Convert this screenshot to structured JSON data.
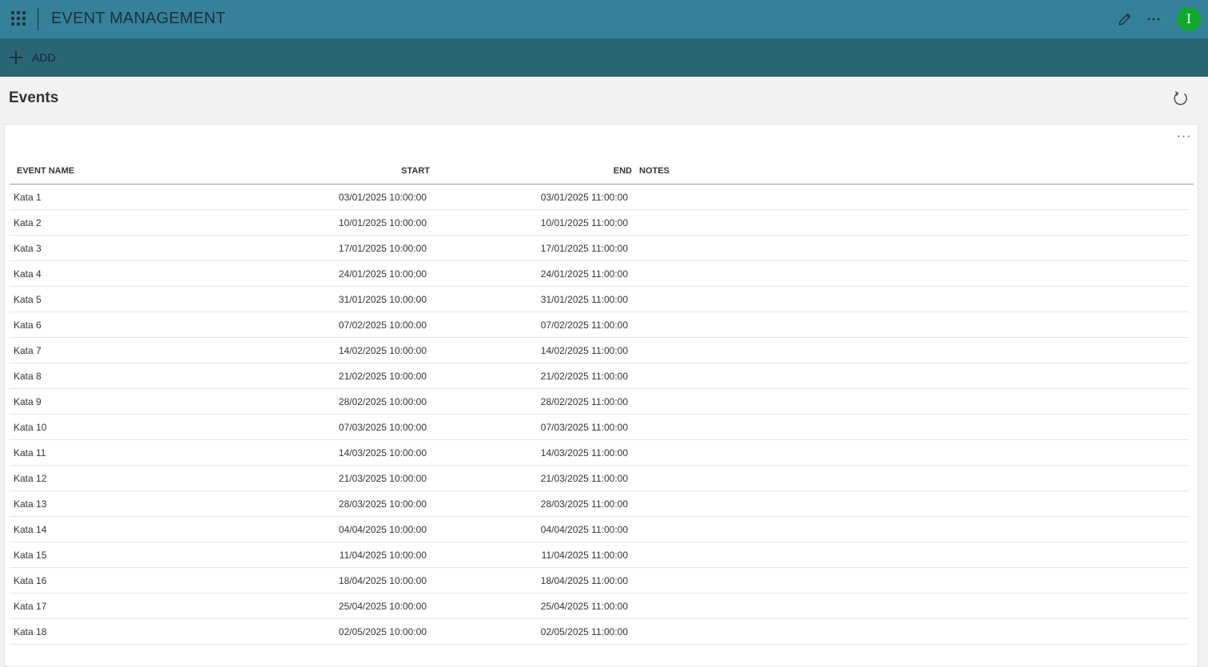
{
  "app": {
    "title": "EVENT MANAGEMENT",
    "avatar_initial": "I",
    "brand_color": "#35819a",
    "command_bar_color": "#2a6576",
    "avatar_color": "#0fa82b"
  },
  "icons": {
    "launcher": "waffle-icon",
    "edit": "pencil-icon",
    "more": "ellipsis-icon",
    "add": "plus-icon",
    "refresh": "refresh-icon"
  },
  "command_bar": {
    "add_label": "ADD"
  },
  "page": {
    "title": "Events"
  },
  "table": {
    "columns": {
      "name": "EVENT NAME",
      "start": "START",
      "end": "END",
      "notes": "NOTES"
    },
    "rows": [
      {
        "name": "Kata 1",
        "start": "03/01/2025 10:00:00",
        "end": "03/01/2025 11:00:00",
        "notes": ""
      },
      {
        "name": "Kata 2",
        "start": "10/01/2025 10:00:00",
        "end": "10/01/2025 11:00:00",
        "notes": ""
      },
      {
        "name": "Kata 3",
        "start": "17/01/2025 10:00:00",
        "end": "17/01/2025 11:00:00",
        "notes": ""
      },
      {
        "name": "Kata 4",
        "start": "24/01/2025 10:00:00",
        "end": "24/01/2025 11:00:00",
        "notes": ""
      },
      {
        "name": "Kata 5",
        "start": "31/01/2025 10:00:00",
        "end": "31/01/2025 11:00:00",
        "notes": ""
      },
      {
        "name": "Kata 6",
        "start": "07/02/2025 10:00:00",
        "end": "07/02/2025 11:00:00",
        "notes": ""
      },
      {
        "name": "Kata 7",
        "start": "14/02/2025 10:00:00",
        "end": "14/02/2025 11:00:00",
        "notes": ""
      },
      {
        "name": "Kata 8",
        "start": "21/02/2025 10:00:00",
        "end": "21/02/2025 11:00:00",
        "notes": ""
      },
      {
        "name": "Kata 9",
        "start": "28/02/2025 10:00:00",
        "end": "28/02/2025 11:00:00",
        "notes": ""
      },
      {
        "name": "Kata 10",
        "start": "07/03/2025 10:00:00",
        "end": "07/03/2025 11:00:00",
        "notes": ""
      },
      {
        "name": "Kata 11",
        "start": "14/03/2025 10:00:00",
        "end": "14/03/2025 11:00:00",
        "notes": ""
      },
      {
        "name": "Kata 12",
        "start": "21/03/2025 10:00:00",
        "end": "21/03/2025 11:00:00",
        "notes": ""
      },
      {
        "name": "Kata 13",
        "start": "28/03/2025 10:00:00",
        "end": "28/03/2025 11:00:00",
        "notes": ""
      },
      {
        "name": "Kata 14",
        "start": "04/04/2025 10:00:00",
        "end": "04/04/2025 11:00:00",
        "notes": ""
      },
      {
        "name": "Kata 15",
        "start": "11/04/2025 10:00:00",
        "end": "11/04/2025 11:00:00",
        "notes": ""
      },
      {
        "name": "Kata 16",
        "start": "18/04/2025 10:00:00",
        "end": "18/04/2025 11:00:00",
        "notes": ""
      },
      {
        "name": "Kata 17",
        "start": "25/04/2025 10:00:00",
        "end": "25/04/2025 11:00:00",
        "notes": ""
      },
      {
        "name": "Kata 18",
        "start": "02/05/2025 10:00:00",
        "end": "02/05/2025 11:00:00",
        "notes": ""
      }
    ]
  }
}
